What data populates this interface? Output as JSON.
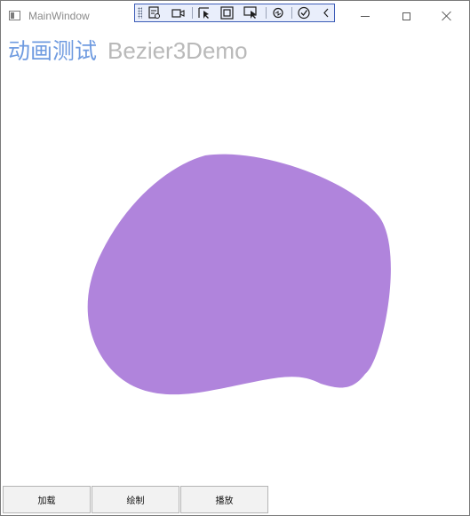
{
  "window": {
    "title": "MainWindow"
  },
  "heading": {
    "chinese": "动画测试",
    "english": "Bezier3Demo"
  },
  "canvas": {
    "blob_color": "#b084dc",
    "heading_cn_color": "#6f9be0",
    "heading_en_color": "#b9b9b9"
  },
  "debug_toolbar": {
    "icons": [
      "live-visual-tree-icon",
      "camera-icon",
      "select-element-icon",
      "layout-adorner-icon",
      "track-focus-icon",
      "hot-reload-icon",
      "verify-icon",
      "collapse-chevron-icon"
    ],
    "border_color": "#3c5cb7",
    "background_color": "#e9eefb"
  },
  "buttons": {
    "load": "加载",
    "draw": "绘制",
    "play": "播放"
  }
}
